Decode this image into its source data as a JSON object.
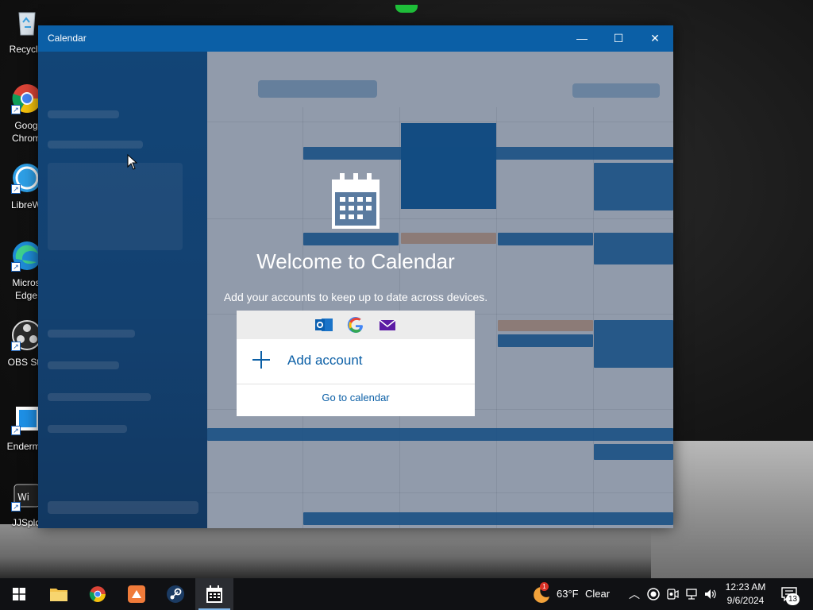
{
  "desktop": {
    "icons": [
      {
        "label": "Recycle",
        "icon": "recycle-bin-icon"
      },
      {
        "label": "Goog Chrom",
        "icon": "chrome-icon"
      },
      {
        "label": "LibreW",
        "icon": "librewolf-icon"
      },
      {
        "label": "Micros Edge",
        "icon": "edge-icon"
      },
      {
        "label": "OBS Stu",
        "icon": "obs-icon"
      },
      {
        "label": "Enderma",
        "icon": "enderman-icon"
      },
      {
        "label": "JJSplo",
        "icon": "jjsploit-icon"
      }
    ]
  },
  "window": {
    "title": "Calendar",
    "controls": {
      "minimize": "—",
      "maximize": "☐",
      "close": "✕"
    }
  },
  "welcome": {
    "title": "Welcome to Calendar",
    "subtitle": "Add your accounts to keep up to date across devices.",
    "add_account": "Add account",
    "go_to_calendar": "Go to calendar",
    "providers": [
      "outlook-icon",
      "google-icon",
      "mail-icon"
    ]
  },
  "taskbar": {
    "apps": [
      "start-icon",
      "file-explorer-icon",
      "chrome-icon",
      "app-icon",
      "steam-icon",
      "calendar-icon"
    ],
    "weather": {
      "temp": "63°F",
      "condition": "Clear",
      "badge": "1"
    },
    "clock": {
      "time": "12:23 AM",
      "date": "9/6/2024"
    },
    "notifications": "13"
  },
  "colors": {
    "accent": "#0b5fa6",
    "taskbar": "#101114"
  }
}
